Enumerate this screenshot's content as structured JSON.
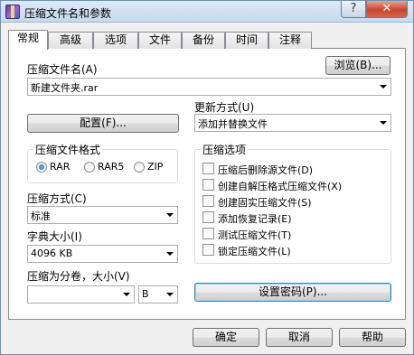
{
  "window": {
    "title": "压缩文件名和参数",
    "help_button": "?",
    "close_button": "✕"
  },
  "tabs": [
    {
      "label": "常规",
      "active": true
    },
    {
      "label": "高级",
      "active": false
    },
    {
      "label": "选项",
      "active": false
    },
    {
      "label": "文件",
      "active": false
    },
    {
      "label": "备份",
      "active": false
    },
    {
      "label": "时间",
      "active": false
    },
    {
      "label": "注释",
      "active": false
    }
  ],
  "general": {
    "archive_name_label": "压缩文件名(A)",
    "browse_button": "浏览(B)...",
    "archive_name_value": "新建文件夹.rar",
    "update_mode_label": "更新方式(U)",
    "update_mode_value": "添加并替换文件",
    "profiles_button": "配置(F)...",
    "format_group": {
      "legend": "压缩文件格式",
      "options": [
        {
          "label": "RAR",
          "checked": true
        },
        {
          "label": "RAR5",
          "checked": false
        },
        {
          "label": "ZIP",
          "checked": false
        }
      ]
    },
    "method_label": "压缩方式(C)",
    "method_value": "标准",
    "dict_label": "字典大小(I)",
    "dict_value": "4096 KB",
    "split_label": "压缩为分卷，大小(V)",
    "split_value": "",
    "split_unit": "B",
    "options_group": {
      "legend": "压缩选项",
      "items": [
        {
          "label": "压缩后删除源文件(D)",
          "checked": false
        },
        {
          "label": "创建自解压格式压缩文件(X)",
          "checked": false
        },
        {
          "label": "创建固实压缩文件(S)",
          "checked": false
        },
        {
          "label": "添加恢复记录(E)",
          "checked": false
        },
        {
          "label": "测试压缩文件(T)",
          "checked": false
        },
        {
          "label": "锁定压缩文件(L)",
          "checked": false
        }
      ]
    },
    "password_button": "设置密码(P)..."
  },
  "footer": {
    "ok_button": "确定",
    "cancel_button": "取消",
    "help_button": "帮助"
  }
}
